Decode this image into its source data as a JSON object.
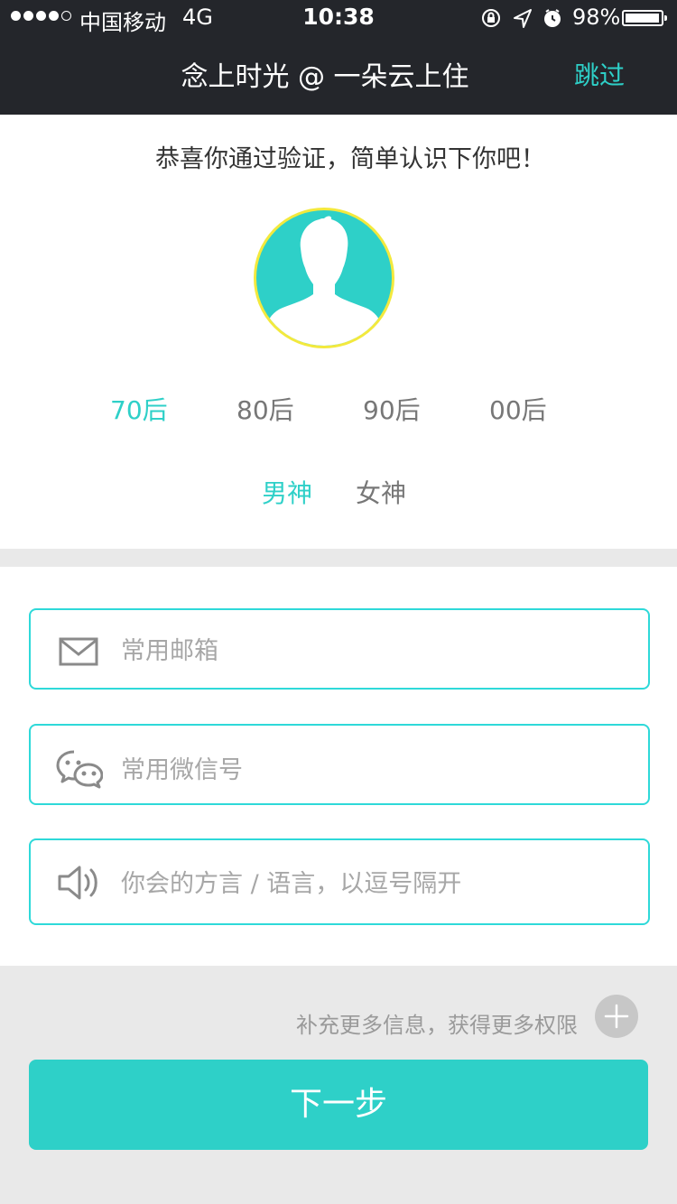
{
  "status_bar": {
    "carrier": "中国移动",
    "network": "4G",
    "time": "10:38",
    "battery_percent": "98%",
    "battery_level": 0.98
  },
  "nav": {
    "title": "念上时光 @ 一朵云上住",
    "skip_label": "跳过"
  },
  "profile": {
    "greeting": "恭喜你通过验证，简单认识下你吧！",
    "avatar_icon": "person-silhouette-icon",
    "eras": [
      {
        "label": "70后",
        "selected": true
      },
      {
        "label": "80后",
        "selected": false
      },
      {
        "label": "90后",
        "selected": false
      },
      {
        "label": "00后",
        "selected": false
      }
    ],
    "genders": [
      {
        "label": "男神",
        "selected": true
      },
      {
        "label": "女神",
        "selected": false
      }
    ]
  },
  "form": {
    "email": {
      "placeholder": "常用邮箱",
      "value": "",
      "icon": "mail-icon"
    },
    "wechat": {
      "placeholder": "常用微信号",
      "value": "",
      "icon": "wechat-icon"
    },
    "language": {
      "placeholder": "你会的方言 / 语言，以逗号隔开",
      "value": "",
      "icon": "speaker-icon"
    }
  },
  "more_info": {
    "text": "补充更多信息，获得更多权限",
    "icon": "plus-icon"
  },
  "next_button": {
    "label": "下一步"
  },
  "colors": {
    "accent": "#2ed0c8",
    "nav_bg": "#24262b",
    "avatar_border": "#f3e93d",
    "field_border": "#2ed9d9",
    "page_bg": "#e9e9e9"
  }
}
